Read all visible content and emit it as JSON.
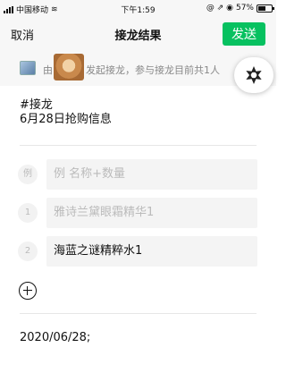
{
  "status_bar": {
    "carrier": "中国移动",
    "time": "下午1:59",
    "icons": "@ ⇗ ◉",
    "battery_text": "57%",
    "battery_level": 0.57
  },
  "nav": {
    "cancel": "取消",
    "title": "接龙结果",
    "send": "发送"
  },
  "info_bar": {
    "by_label": "由",
    "text": "发起接龙，参与接龙目前共1人"
  },
  "content": {
    "title_line1": "#接龙",
    "title_line2": "6月28日抢购信息"
  },
  "rows": [
    {
      "num": "例",
      "text": "例 名称+数量"
    },
    {
      "num": "1",
      "text": "雅诗兰黛眼霜精华1"
    },
    {
      "num": "2",
      "text": "海蓝之谜精粹水1"
    }
  ],
  "footer": {
    "date_text": "2020/06/28;"
  },
  "colors": {
    "accent_green": "#07c160",
    "bar_bg": "#f7f7f7",
    "muted_text": "#888888",
    "placeholder": "#bbbbbb"
  }
}
